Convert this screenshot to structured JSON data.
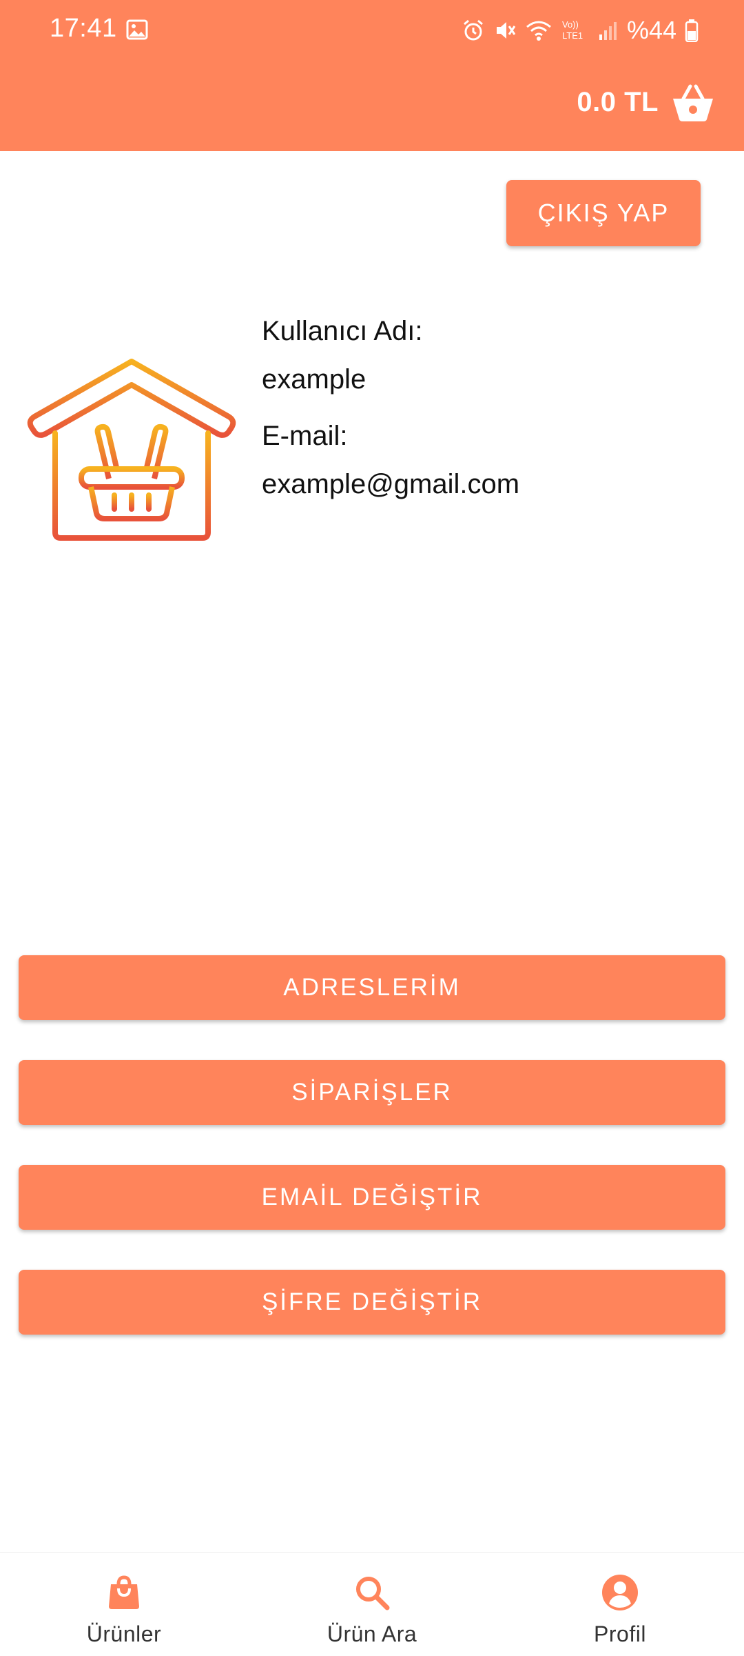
{
  "status_bar": {
    "time": "17:41",
    "battery_text": "%44",
    "network_label": "Vo)) LTE1"
  },
  "header": {
    "cart_total": "0.0 TL",
    "cart_icon": "shopping-basket-icon"
  },
  "profile": {
    "logout_label": "ÇIKIŞ YAP",
    "username_label": "Kullanıcı Adı:",
    "username_value": "example",
    "email_label": "E-mail:",
    "email_value": "example@gmail.com",
    "logo_icon": "home-basket-logo"
  },
  "actions": [
    {
      "label": "ADRESLERİM"
    },
    {
      "label": "SİPARİŞLER"
    },
    {
      "label": "EMAİL DEĞİŞTİR"
    },
    {
      "label": "ŞİFRE DEĞİŞTİR"
    }
  ],
  "bottom_nav": {
    "items": [
      {
        "label": "Ürünler",
        "icon": "shopping-bag-icon"
      },
      {
        "label": "Ürün Ara",
        "icon": "search-icon"
      },
      {
        "label": "Profil",
        "icon": "account-circle-icon"
      }
    ]
  },
  "colors": {
    "accent": "#FF845B",
    "logo_gradient_top": "#F7B21F",
    "logo_gradient_bottom": "#E8523A"
  }
}
